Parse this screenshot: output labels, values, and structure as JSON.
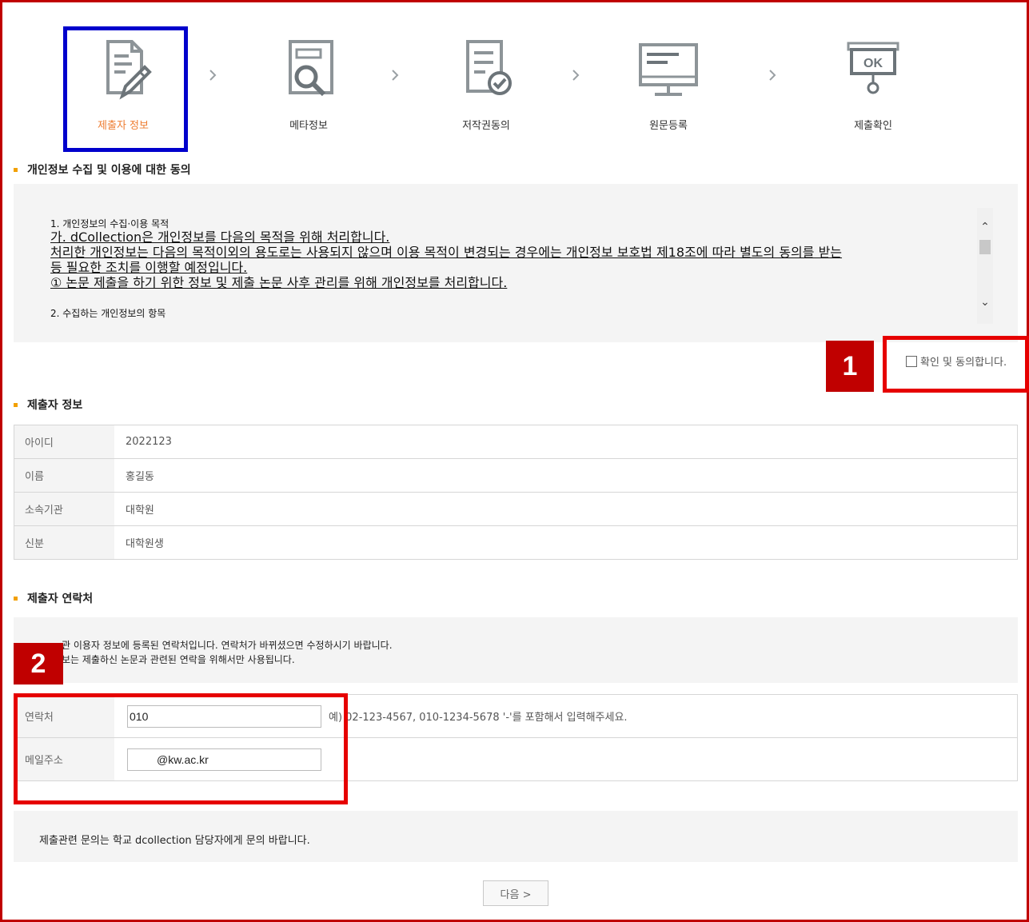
{
  "steps": [
    {
      "label": "제출자 정보",
      "icon": "document-pen-icon",
      "active": true
    },
    {
      "label": "메타정보",
      "icon": "document-search-icon",
      "active": false
    },
    {
      "label": "저작권동의",
      "icon": "document-check-icon",
      "active": false
    },
    {
      "label": "원문등록",
      "icon": "monitor-icon",
      "active": false
    },
    {
      "label": "제출확인",
      "icon": "ok-sign-icon",
      "active": false
    }
  ],
  "privacy": {
    "heading": "개인정보 수집 및 이용에 대한 동의",
    "line1": "1. 개인정보의 수집·이용 목적",
    "line2": "가. dCollection은 개인정보를 다음의 목적을 위해 처리합니다.",
    "line3": "처리한 개인정보는 다음의 목적이외의 용도로는 사용되지 않으며 이용 목적이 변경되는 경우에는 개인정보 보호법 제18조에 따라 별도의 동의를 받는",
    "line4": "등 필요한 조치를 이행할 예정입니다.",
    "line5": "① 논문 제출을 하기 위한 정보 및 제출 논문 사후 관리를 위해 개인정보를 처리합니다.",
    "line6": "2. 수집하는 개인정보의 항목",
    "agree_label": "확인 및 동의합니다.",
    "agree_checked": false
  },
  "annotations": {
    "badge1": "1",
    "badge2": "2"
  },
  "submitter": {
    "heading": "제출자 정보",
    "rows": [
      {
        "key": "아이디",
        "value": "2022123"
      },
      {
        "key": "이름",
        "value": "홍길동"
      },
      {
        "key": "소속기관",
        "value": "대학원"
      },
      {
        "key": "신분",
        "value": "대학원생"
      }
    ]
  },
  "contact": {
    "heading": "제출자 연락처",
    "note1": "관 이용자 정보에 등록된 연락처입니다. 연락처가 바뀌셨으면 수정하시기 바랍니다.",
    "note2": "보는 제출하신 논문과 관련된 연락을 위해서만 사용됩니다.",
    "phone_label": "연락처",
    "phone_value": "010",
    "phone_hint": "예) 02-123-4567, 010-1234-5678 '-'를 포함해서 입력해주세요.",
    "email_label": "메일주소",
    "email_value": "@kw.ac.kr"
  },
  "footer_note": "제출관련 문의는 학교 dcollection 담당자에게 문의 바랍니다.",
  "next_button": "다음 >"
}
